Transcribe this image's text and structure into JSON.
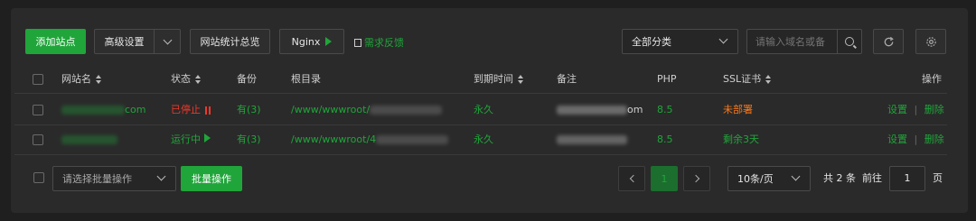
{
  "toolbar": {
    "add_site": "添加站点",
    "advanced_settings": "高级设置",
    "site_stats": "网站统计总览",
    "nginx": "Nginx",
    "feedback": "需求反馈",
    "category_selected": "全部分类",
    "search_placeholder": "请输入域名或备",
    "refresh_icon": "refresh-icon",
    "settings_icon": "gear-icon"
  },
  "table": {
    "headers": {
      "site_name": "网站名",
      "status": "状态",
      "backup": "备份",
      "root_dir": "根目录",
      "expire": "到期时间",
      "remark": "备注",
      "php": "PHP",
      "ssl": "SSL证书",
      "actions": "操作"
    },
    "rows": [
      {
        "site_suffix": "com",
        "status": "已停止",
        "backup": "有(3)",
        "root": "/www/wwwroot/",
        "expire": "永久",
        "remark_suffix": "om",
        "php": "8.5",
        "ssl": "未部署",
        "action_settings": "设置",
        "action_delete": "删除"
      },
      {
        "site_suffix": "",
        "status": "运行中",
        "backup": "有(3)",
        "root": "/www/wwwroot/4",
        "expire": "永久",
        "remark_suffix": "",
        "php": "8.5",
        "ssl": "剩余3天",
        "action_settings": "设置",
        "action_delete": "删除"
      }
    ],
    "separator": "|"
  },
  "footer": {
    "batch_placeholder": "请选择批量操作",
    "batch_button": "批量操作",
    "current_page": "1",
    "page_size": "10条/页",
    "total": "共 2 条",
    "goto_label": "前往",
    "goto_value": "1",
    "page_unit": "页"
  },
  "colors": {
    "accent_green": "#20a53a",
    "stopped_red": "#f0382b",
    "ssl_warn_orange": "#f7781a",
    "panel_bg": "#2a2a2a"
  }
}
